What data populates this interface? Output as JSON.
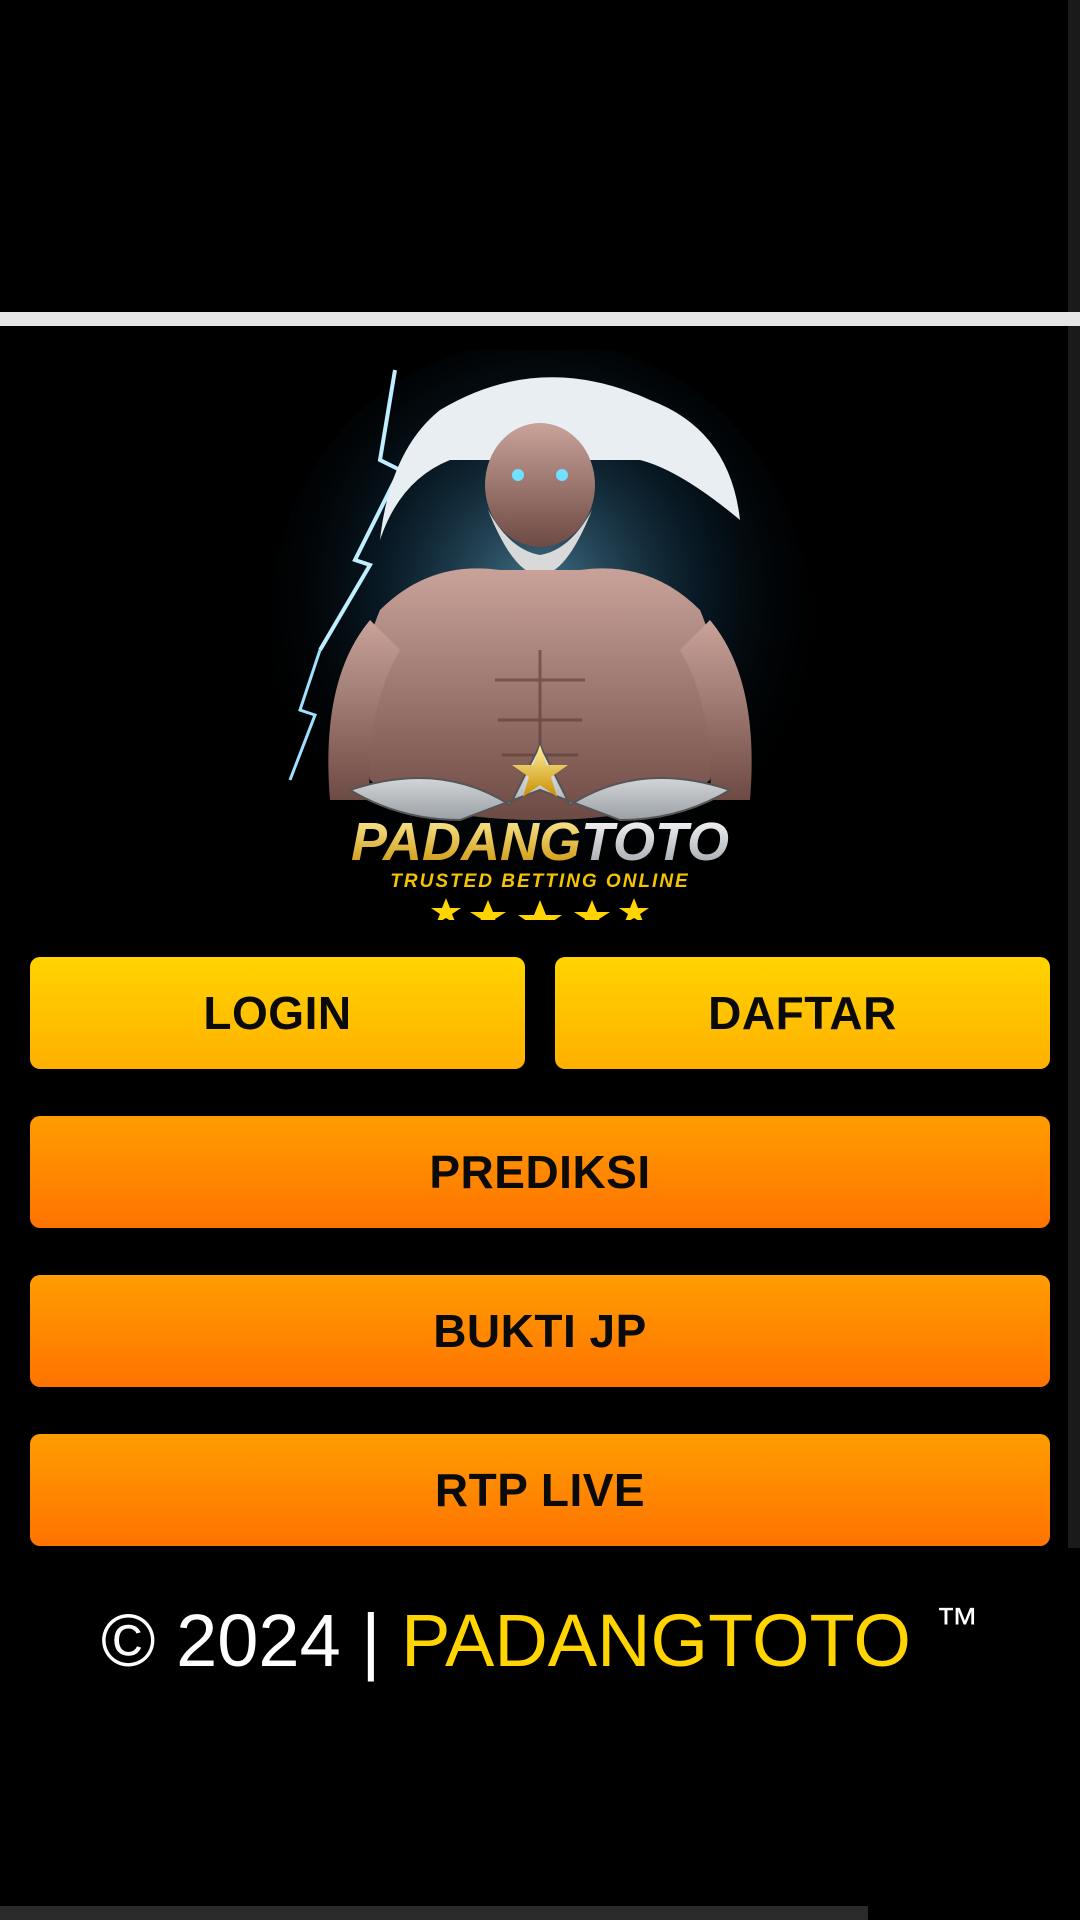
{
  "hero": {
    "logo_text_left": "PADANG",
    "logo_text_right": "TOTO",
    "tagline": "TRUSTED BETTING ONLINE"
  },
  "buttons": {
    "login": "LOGIN",
    "daftar": "DAFTAR",
    "prediksi": "PREDIKSI",
    "bukti_jp": "BUKTI JP",
    "rtp_live": "RTP LIVE"
  },
  "footer": {
    "copyright": "© 2024 |",
    "brand": "PADANGTOTO",
    "tm": "™"
  },
  "colors": {
    "accent_yellow": "#ffd400",
    "accent_orange": "#ff8a00",
    "background": "#000000"
  }
}
